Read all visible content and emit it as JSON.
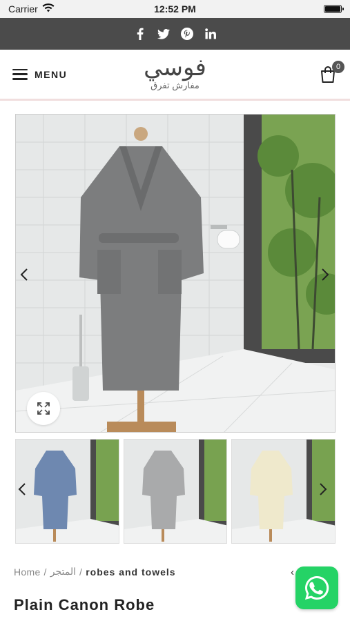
{
  "status_bar": {
    "carrier": "Carrier",
    "time": "12:52 PM"
  },
  "social": {
    "icons": [
      "facebook-icon",
      "twitter-icon",
      "pinterest-icon",
      "linkedin-icon"
    ]
  },
  "header": {
    "menu_label": "MENU",
    "logo_main": "فوسي",
    "logo_sub": "مفارش تفرق",
    "cart_count": "0"
  },
  "gallery": {
    "main_colors": {
      "robe": "#7c7d7e",
      "wall": "#e8eaea",
      "window": "#6f9a4a"
    },
    "thumb_colors": [
      "#6e88b0",
      "#a9aaab",
      "#efe9cc"
    ]
  },
  "breadcrumb": {
    "home": "Home",
    "sep": "/",
    "shop": "المتجر",
    "current": "robes and towels",
    "chevron": "‹"
  },
  "product": {
    "title": "Plain Canon Robe"
  },
  "colors": {
    "social_bar": "#4b4b4b",
    "whatsapp": "#25d366"
  }
}
